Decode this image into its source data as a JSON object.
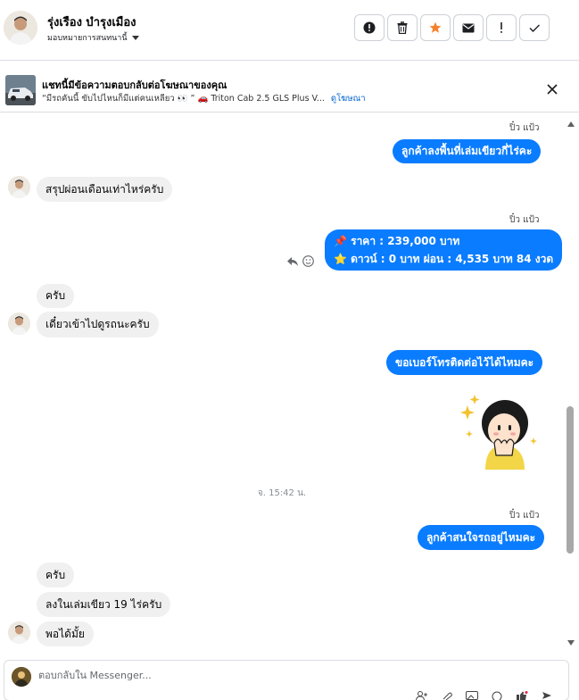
{
  "header": {
    "name": "รุ่งเรือง บำรุงเมือง",
    "assign_label": "มอบหมายการสนทนานี้",
    "actions": [
      {
        "icon": "alert-circle-icon"
      },
      {
        "icon": "trash-icon"
      },
      {
        "icon": "star-icon"
      },
      {
        "icon": "envelope-icon"
      },
      {
        "icon": "exclamation-icon"
      },
      {
        "icon": "check-icon"
      }
    ],
    "star_color": "#f5822a"
  },
  "ad": {
    "title": "แชทนี้มีข้อความตอบกลับต่อโฆษณาของคุณ",
    "description": "“มีรถคันนี้ ขับไปไหนก็มีแต่คนเหลียว 👀 ” 🚗 Triton Cab 2.5 GLS Plus V...",
    "link": "ดูโฆษณา"
  },
  "messages": {
    "seen_1": "ปิ๋ว แป้ว",
    "out_1": "ลูกค้าลงพื้นที่เล่มเขียวกี่ไร่คะ",
    "in_1": "สรุปผ่อนเดือนเท่าไหร่ครับ",
    "seen_2": "ปิ๋ว แป้ว",
    "out_2_line1": "📌 ราคา : 239,000 บาท",
    "out_2_line2": "⭐ ดาวน์ : 0 บาท ผ่อน : 4,535 บาท 84 งวด",
    "in_2": "ครับ",
    "in_3": "เดี๋ยวเข้าไปดูรถนะครับ",
    "out_3": "ขอเบอร์โทรติดต่อไว้ได้ไหมคะ",
    "timestamp": "จ. 15:42 น.",
    "seen_3": "ปิ๋ว แป้ว",
    "out_4": "ลูกค้าสนใจรถอยู่ไหมคะ",
    "in_4": "ครับ",
    "in_5": "ลงในเล่มเขียว 19 ไร่ครับ",
    "in_6": "พอได้มั้ย"
  },
  "composer": {
    "placeholder": "ตอบกลับใน Messenger...",
    "tools": [
      "add-person-icon",
      "attach-icon",
      "image-icon",
      "emoji-icon",
      "like-icon",
      "send-icon"
    ]
  },
  "colors": {
    "bubble_out": "#0a7cff",
    "bubble_in": "#f0f0f0",
    "link": "#0064d1"
  }
}
